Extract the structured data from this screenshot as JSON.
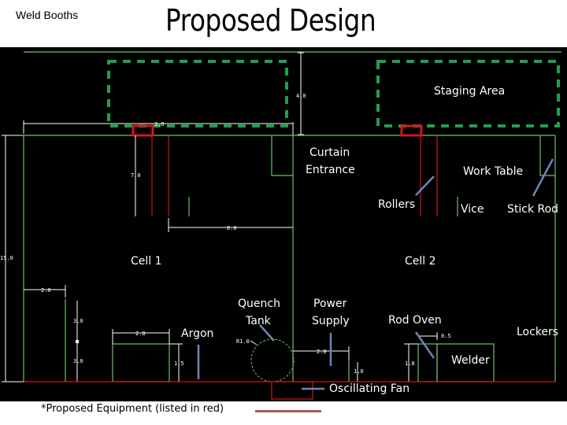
{
  "header": {
    "subtitle": "Weld Booths",
    "title": "Proposed Design"
  },
  "colors": {
    "walls": "#6fbf6a",
    "staging": "#1fa050",
    "proposed": "#d01818",
    "dimension": "#ffffff",
    "arrow": "#6b86b8",
    "background": "#000000",
    "legend_line": "#a8585c"
  },
  "labels": {
    "staging_area": "Staging Area",
    "curtain_entrance_1": "Curtain",
    "curtain_entrance_2": "Entrance",
    "work_table": "Work Table",
    "rollers": "Rollers",
    "vice": "Vice",
    "stick_rod": "Stick Rod",
    "cell_1": "Cell 1",
    "cell_2": "Cell 2",
    "quench_tank_1": "Quench",
    "quench_tank_2": "Tank",
    "power_supply_1": "Power",
    "power_supply_2": "Supply",
    "argon": "Argon",
    "rod_oven": "Rod Oven",
    "lockers": "Lockers",
    "welder": "Welder",
    "oscillating_fan": "Oscillating Fan"
  },
  "dimensions": {
    "staging_height": "4.0",
    "roller_gap": "3.0",
    "roller_height": "7.0",
    "cell_width": "8.0",
    "room_height": "15.0",
    "booth_offset": "2.0",
    "upper_vertical": "3.0",
    "lower_vertical": "3.0",
    "table_width": "2.8",
    "table_height": "1.5",
    "tank_radius": "R1.0",
    "power_offset": "2.8",
    "power_height": "1.0",
    "oven_height": "1.8",
    "oven_width": "0.5"
  },
  "footer": {
    "note": "*Proposed Equipment (listed in red)"
  }
}
